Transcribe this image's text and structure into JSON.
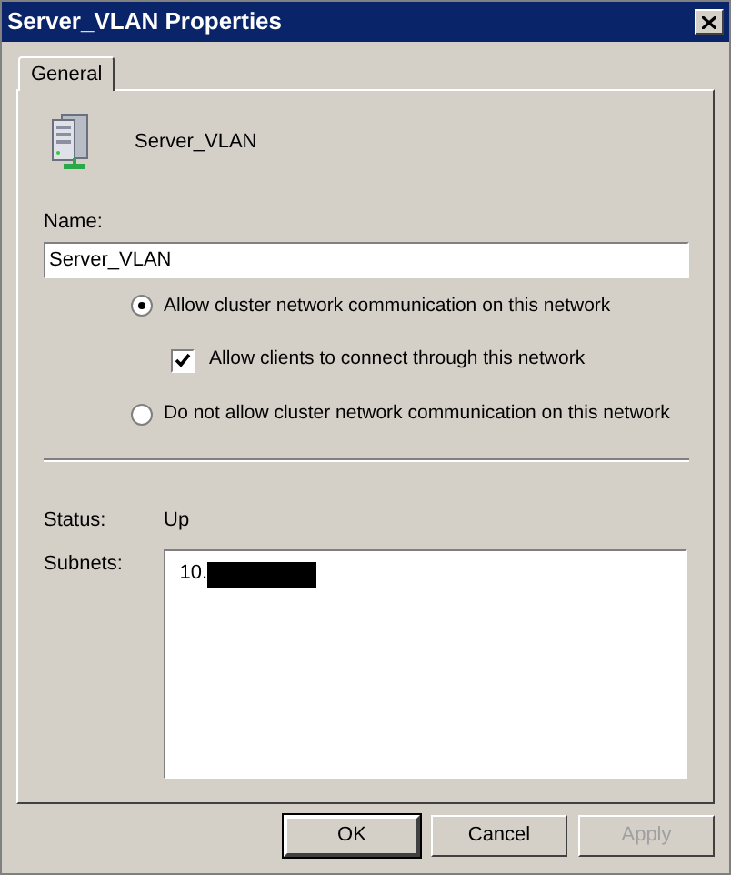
{
  "window": {
    "title": "Server_VLAN Properties"
  },
  "tabs": [
    {
      "label": "General",
      "selected": true
    }
  ],
  "header": {
    "name": "Server_VLAN"
  },
  "name_field": {
    "label": "Name:",
    "value": "Server_VLAN"
  },
  "options": [
    {
      "kind": "radio",
      "label": "Allow cluster network communication on this network",
      "selected": true
    },
    {
      "kind": "checkbox",
      "label": "Allow clients to connect through this network",
      "checked": true
    },
    {
      "kind": "radio",
      "label": "Do not allow cluster network communication on this network",
      "selected": false
    }
  ],
  "status": {
    "label": "Status:",
    "value": "Up"
  },
  "subnets": {
    "label": "Subnets:",
    "items": [
      {
        "text": "10.",
        "redacted": true
      }
    ]
  },
  "buttons": [
    {
      "label": "OK",
      "default": true,
      "disabled": false
    },
    {
      "label": "Cancel",
      "default": false,
      "disabled": false
    },
    {
      "label": "Apply",
      "default": false,
      "disabled": true
    }
  ]
}
